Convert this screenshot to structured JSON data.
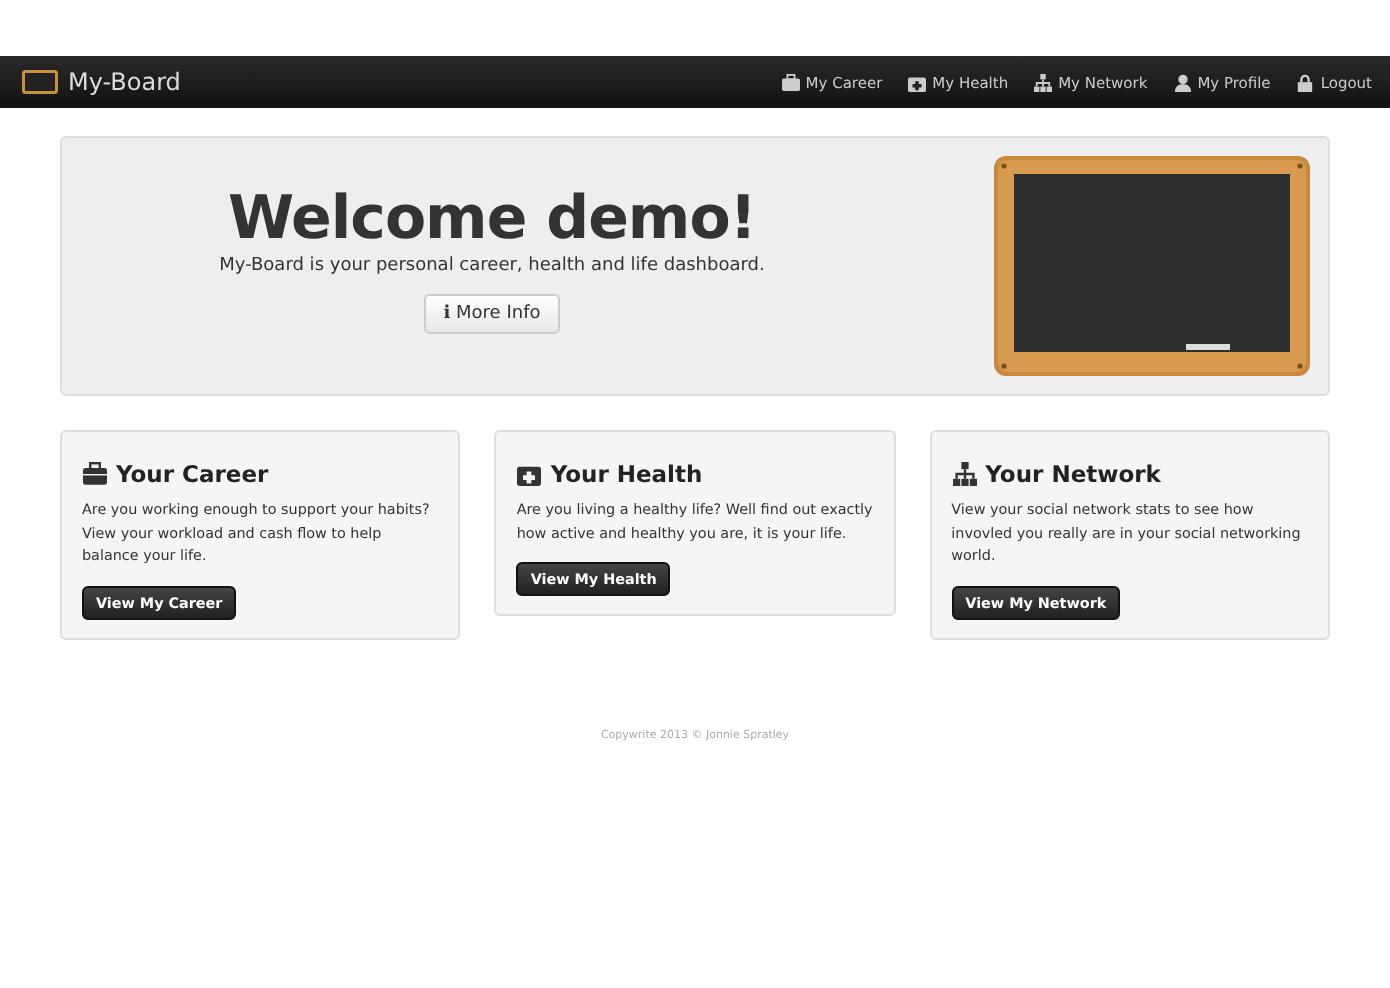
{
  "navbar": {
    "brand": "My-Board",
    "items": [
      {
        "label": "My Career",
        "kind": "briefcase"
      },
      {
        "label": "My Health",
        "kind": "medkit"
      },
      {
        "label": "My Network",
        "kind": "sitemap"
      },
      {
        "label": "My Profile",
        "kind": "user"
      },
      {
        "label": "Logout",
        "kind": "lock"
      }
    ]
  },
  "hero": {
    "title": "Welcome demo!",
    "subtitle": "My-Board is your personal career, health and life dashboard.",
    "button": {
      "icon": "i",
      "label": "More Info"
    }
  },
  "cards": [
    {
      "kind": "briefcase",
      "title": "Your Career",
      "text": "Are you working enough to support your habits? View your workload and cash flow to help balance your life.",
      "button": "View My Career"
    },
    {
      "kind": "medkit",
      "title": "Your Health",
      "text": "Are you living a healthy life? Well find out exactly how active and healthy you are, it is your life.",
      "button": "View My Health"
    },
    {
      "kind": "sitemap",
      "title": "Your Network",
      "text": "View your social network stats to see how invovled you really are in your social networking world.",
      "button": "View My Network"
    }
  ],
  "footer": "Copywrite 2013 © Jonnie Spratley"
}
